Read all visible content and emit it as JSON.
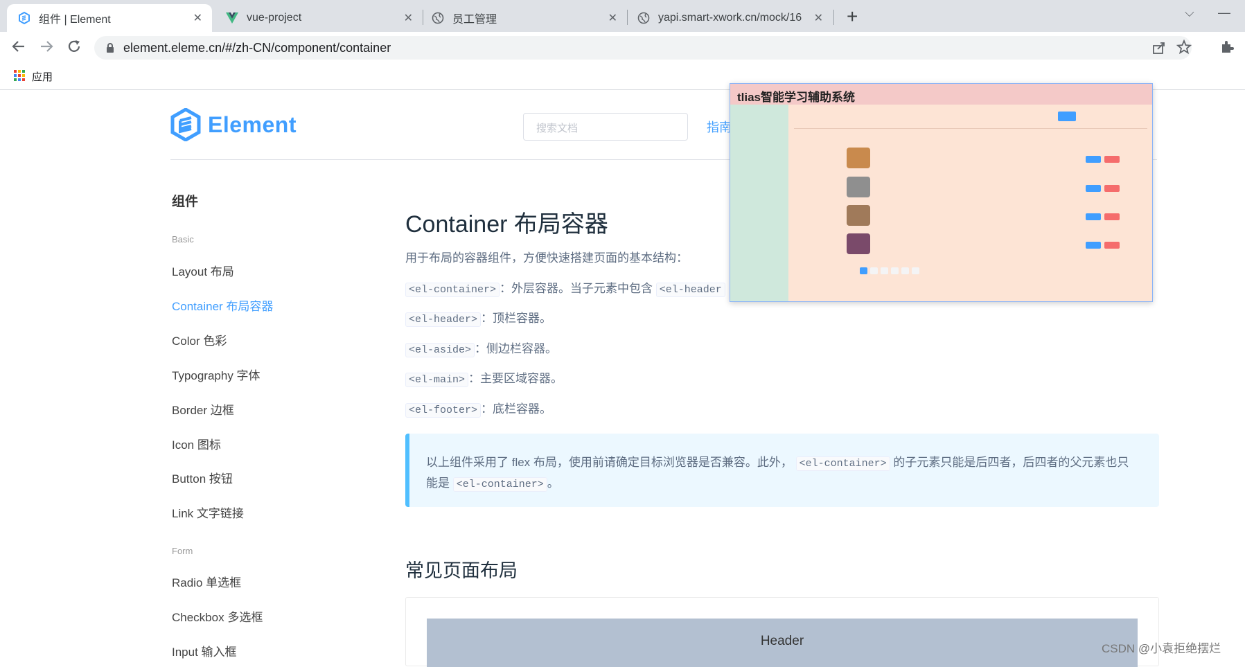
{
  "browser": {
    "tabs": [
      {
        "title": "组件 | Element",
        "active": true,
        "icon": "element-favicon"
      },
      {
        "title": "vue-project",
        "active": false,
        "icon": "vue-favicon"
      },
      {
        "title": "员工管理",
        "active": false,
        "icon": "globe-icon"
      },
      {
        "title": "yapi.smart-xwork.cn/mock/16",
        "active": false,
        "icon": "globe-icon"
      }
    ],
    "url": "element.eleme.cn/#/zh-CN/component/container",
    "bookmark_apps": "应用"
  },
  "header": {
    "logo_text": "Element",
    "search_placeholder": "搜索文档",
    "nav_guide": "指南"
  },
  "sidebar": {
    "title": "组件",
    "groups": [
      {
        "label": "Basic",
        "items": [
          {
            "label": "Layout 布局",
            "active": false
          },
          {
            "label": "Container 布局容器",
            "active": true
          },
          {
            "label": "Color 色彩",
            "active": false
          },
          {
            "label": "Typography 字体",
            "active": false
          },
          {
            "label": "Border 边框",
            "active": false
          },
          {
            "label": "Icon 图标",
            "active": false
          },
          {
            "label": "Button 按钮",
            "active": false
          },
          {
            "label": "Link 文字链接",
            "active": false
          }
        ]
      },
      {
        "label": "Form",
        "items": [
          {
            "label": "Radio 单选框",
            "active": false
          },
          {
            "label": "Checkbox 多选框",
            "active": false
          },
          {
            "label": "Input 输入框",
            "active": false
          }
        ]
      }
    ]
  },
  "content": {
    "title": "Container 布局容器",
    "intro": "用于布局的容器组件，方便快速搭建页面的基本结构：",
    "components": [
      {
        "code": "<el-container>",
        "desc": "：外层容器。当子元素中包含",
        "code2": "<el-header"
      },
      {
        "code": "<el-header>",
        "desc": "：顶栏容器。",
        "code2": ""
      },
      {
        "code": "<el-aside>",
        "desc": "：侧边栏容器。",
        "code2": ""
      },
      {
        "code": "<el-main>",
        "desc": "：主要区域容器。",
        "code2": ""
      },
      {
        "code": "<el-footer>",
        "desc": "：底栏容器。",
        "code2": ""
      }
    ],
    "tip_part1": "以上组件采用了 flex 布局，使用前请确定目标浏览器是否兼容。此外，",
    "tip_code1": "<el-container>",
    "tip_part2": "的子元素只能是后四者，后四者的父元素也只",
    "tip_part3": "能是",
    "tip_code2": "<el-container>",
    "tip_part4": "。",
    "section2_title": "常见页面布局",
    "demo_header": "Header"
  },
  "pip_window": {
    "title": "tlias智能学习辅助系统"
  },
  "watermark": "CSDN @小袁拒绝摆烂"
}
